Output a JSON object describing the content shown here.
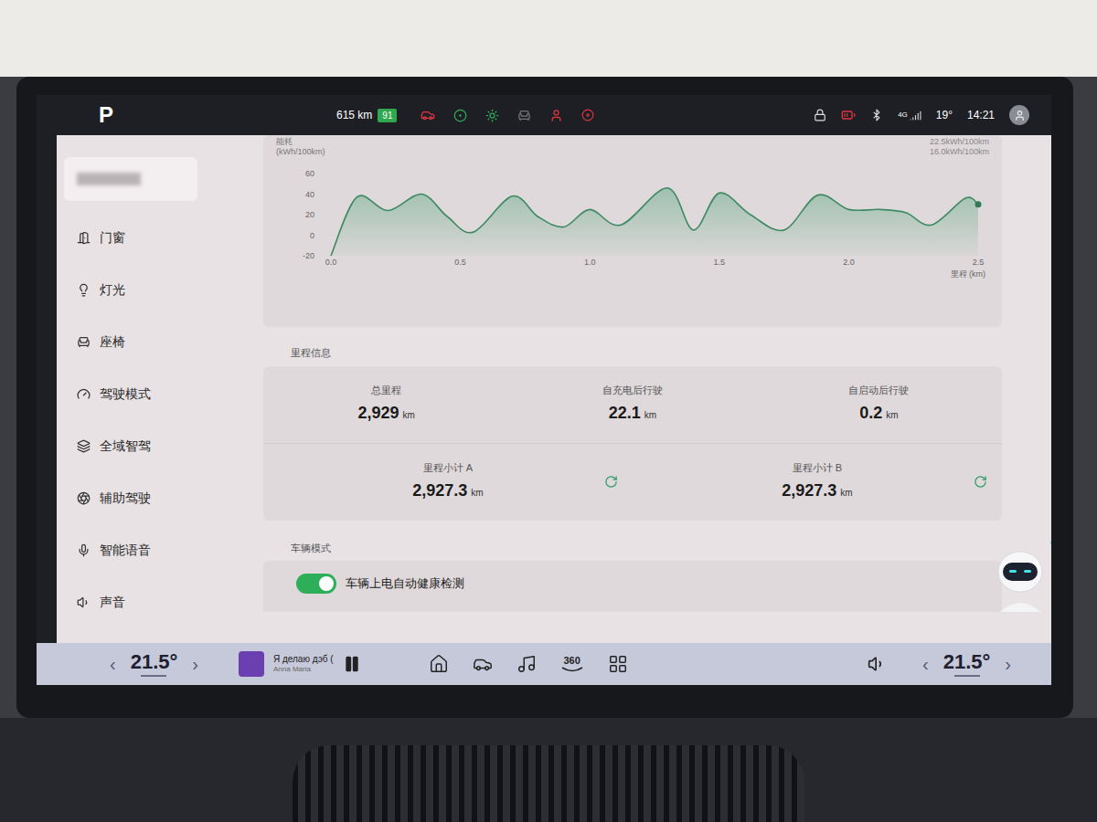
{
  "status_bar": {
    "gear": "P",
    "range": "615 km",
    "battery": "91",
    "network": "4G",
    "temperature": "19°",
    "time": "14:21"
  },
  "sidebar": {
    "items": [
      {
        "label": "门窗",
        "selected": false
      },
      {
        "label": "灯光",
        "selected": false
      },
      {
        "label": "座椅",
        "selected": false
      },
      {
        "label": "驾驶模式",
        "selected": false
      },
      {
        "label": "全域智驾",
        "selected": false
      },
      {
        "label": "辅助驾驶",
        "selected": false
      },
      {
        "label": "智能语音",
        "selected": false
      },
      {
        "label": "声音",
        "selected": false
      }
    ]
  },
  "chart": {
    "title": "能耗",
    "unit": "(kWh/100km)",
    "stats": [
      "22.5kWh/100km",
      "16.0kWh/100km"
    ],
    "y_ticks": [
      "60",
      "40",
      "20",
      "0",
      "-20"
    ],
    "x_ticks": [
      "0.0",
      "0.5",
      "1.0",
      "1.5",
      "2.0",
      "2.5"
    ],
    "x_label": "里程 (km)",
    "series": [
      {
        "distance": [
          0,
          0.1,
          0.22,
          0.35,
          0.45,
          0.55,
          0.7,
          0.8,
          0.9,
          1.0,
          1.12,
          1.3,
          1.4,
          1.5,
          1.62,
          1.75,
          1.88,
          2.0,
          2.12,
          2.22,
          2.32,
          2.45,
          2.5
        ],
        "values": [
          -20,
          37,
          24,
          40,
          18,
          3,
          38,
          18,
          8,
          25,
          10,
          46,
          5,
          41,
          20,
          5,
          39,
          25,
          25,
          22,
          10,
          36,
          30
        ]
      }
    ]
  },
  "mileage": {
    "title": "里程信息",
    "rows": [
      [
        {
          "label": "总里程",
          "value": "2,929",
          "unit": "km",
          "resettable": false
        },
        {
          "label": "自充电后行驶",
          "value": "22.1",
          "unit": "km",
          "resettable": false
        },
        {
          "label": "自启动后行驶",
          "value": "0.2",
          "unit": "km",
          "resettable": false
        }
      ],
      [
        {
          "label": "里程小计 A",
          "value": "2,927.3",
          "unit": "km",
          "resettable": true
        },
        {
          "label": "里程小计 B",
          "value": "2,927.3",
          "unit": "km",
          "resettable": true
        }
      ]
    ]
  },
  "vehicle_mode": {
    "title": "车辆模式",
    "toggles": [
      {
        "label": "车辆上电自动健康检测",
        "on": true
      }
    ]
  },
  "bottom_bar": {
    "left_climate": {
      "prev": "‹",
      "value": "21.5°",
      "next": "›"
    },
    "right_climate": {
      "prev": "‹",
      "value": "21.5°",
      "next": "›"
    },
    "media": {
      "title": "Я делаю дэб (",
      "artist": "Anna Maria",
      "playing": true
    },
    "panoramic": "360"
  }
}
